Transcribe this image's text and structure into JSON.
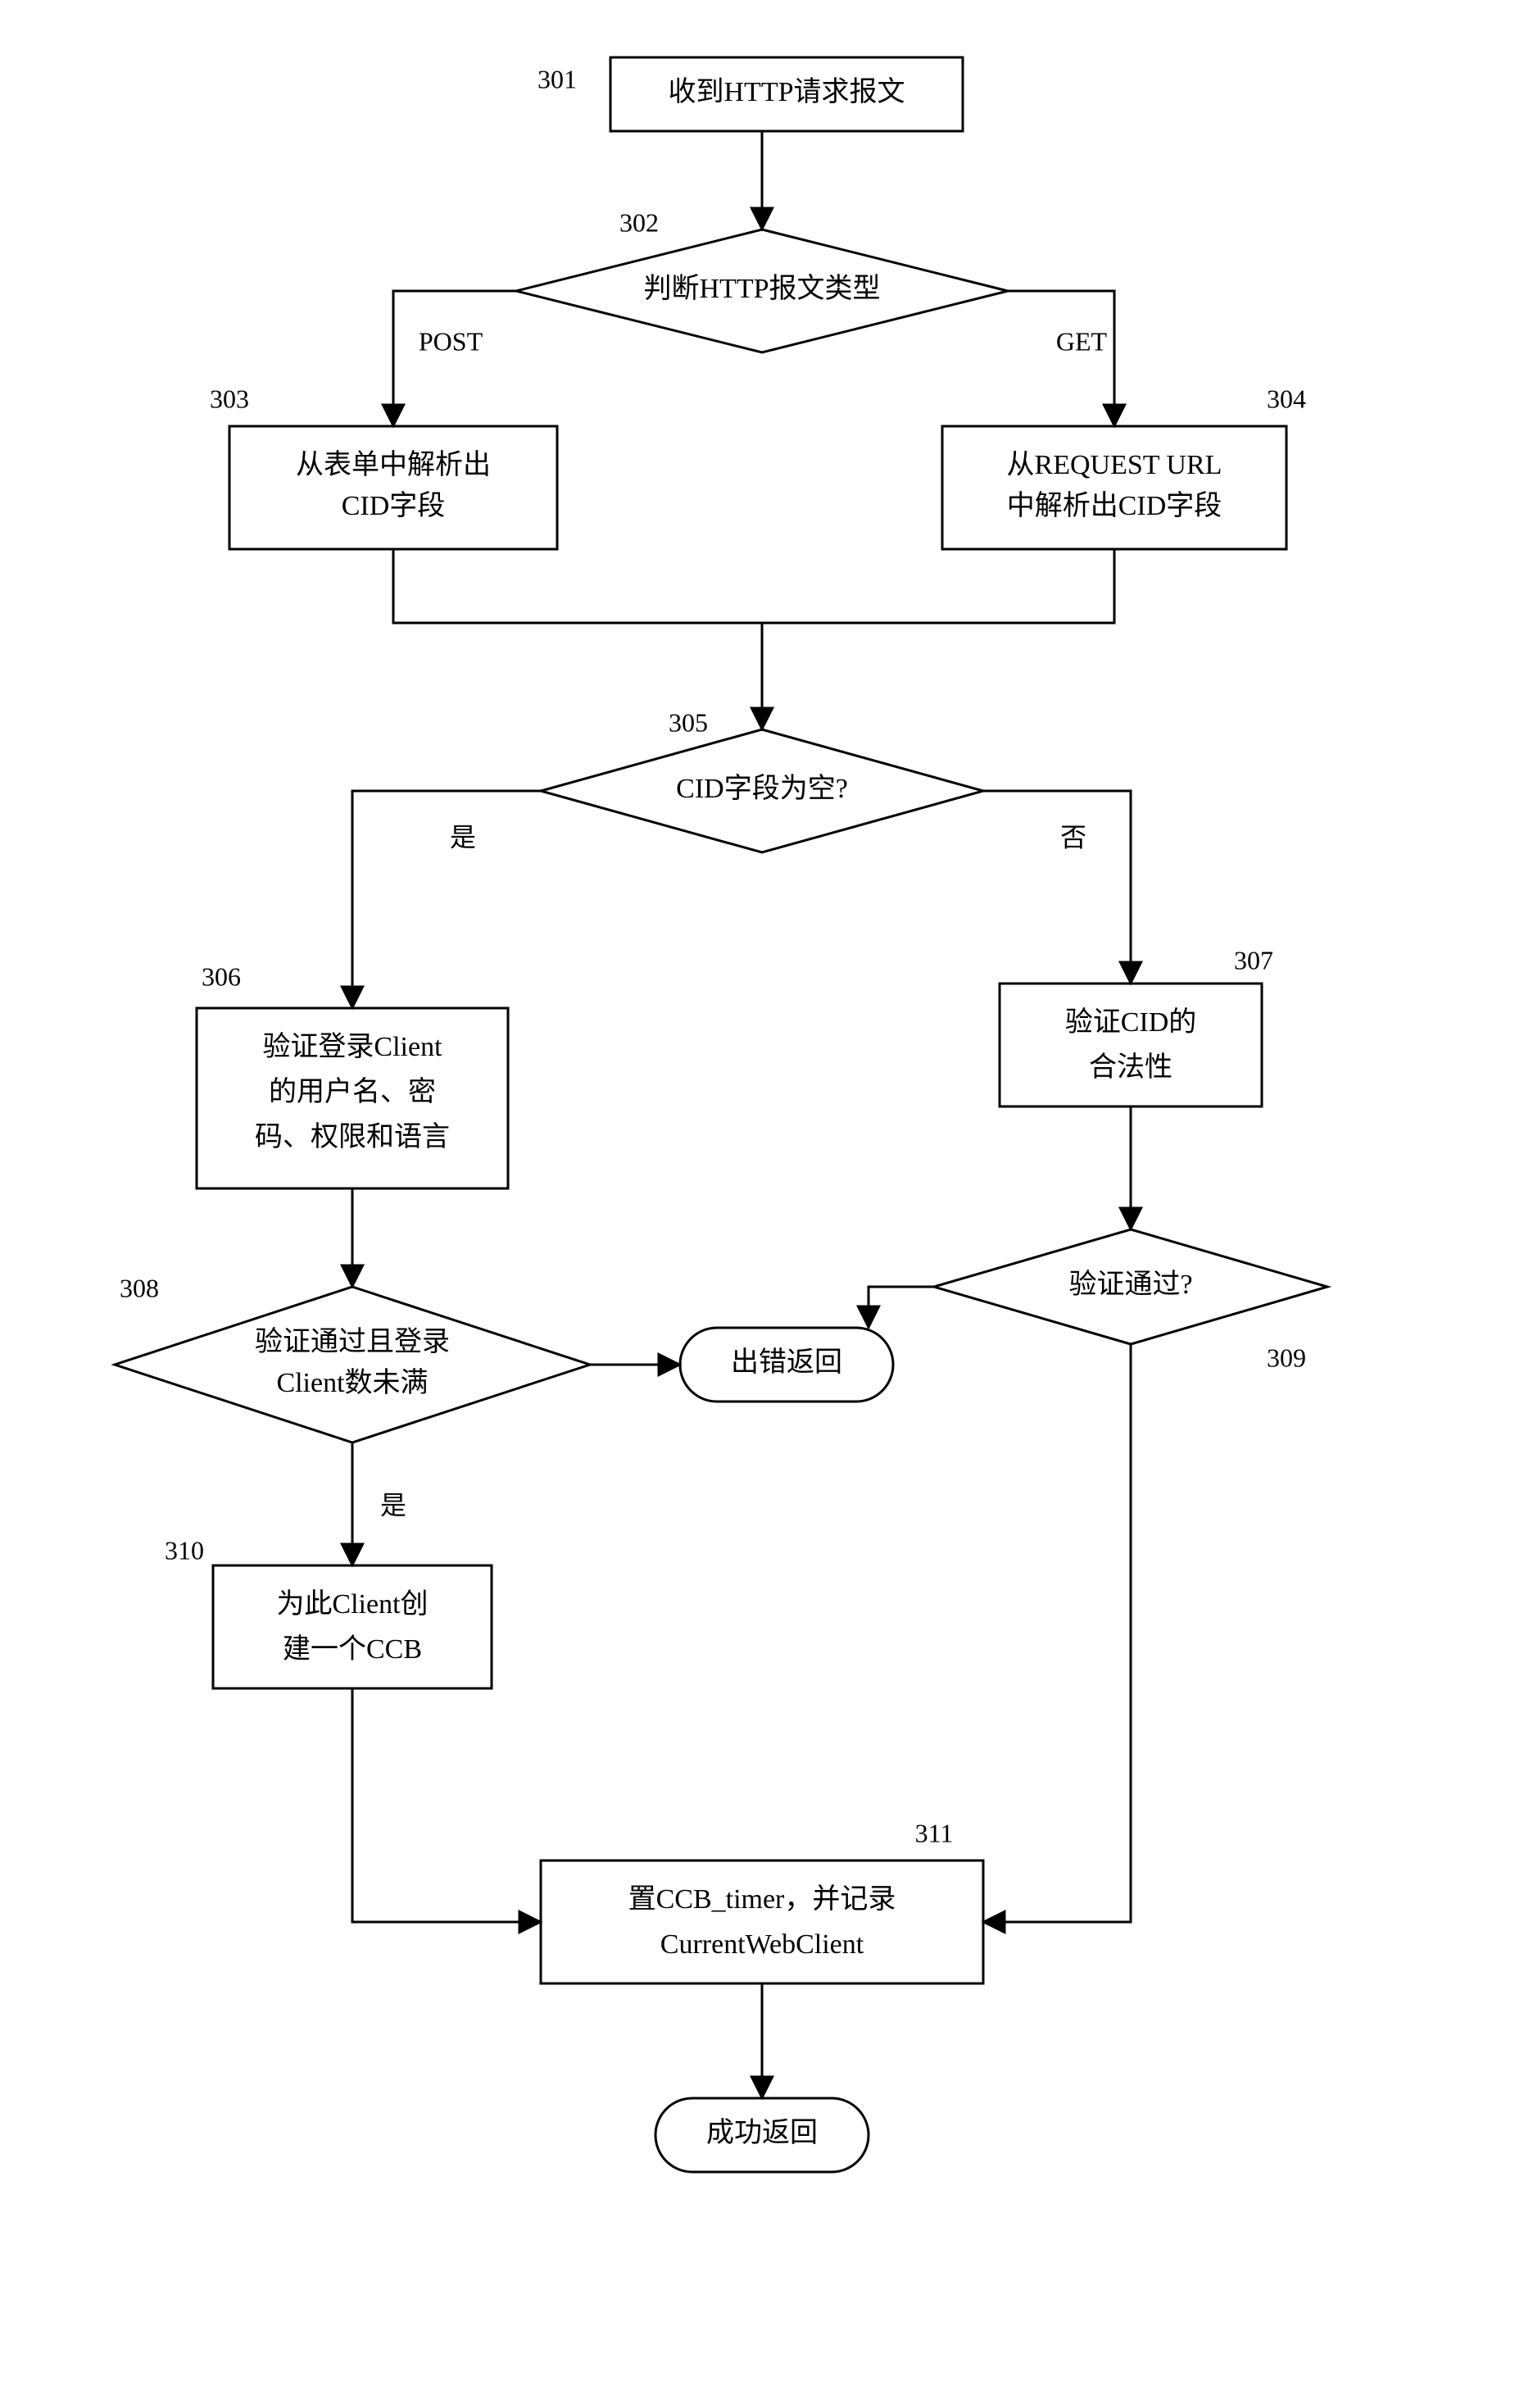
{
  "nodes": {
    "n301": {
      "num": "301",
      "lines": [
        "收到HTTP请求报文"
      ]
    },
    "n302": {
      "num": "302",
      "lines": [
        "判断HTTP报文类型"
      ]
    },
    "n303": {
      "num": "303",
      "lines": [
        "从表单中解析出",
        "CID字段"
      ]
    },
    "n304": {
      "num": "304",
      "lines": [
        "从REQUEST URL",
        "中解析出CID字段"
      ]
    },
    "n305": {
      "num": "305",
      "lines": [
        "CID字段为空?"
      ]
    },
    "n306": {
      "num": "306",
      "lines": [
        "验证登录Client",
        "的用户名、密",
        "码、权限和语言"
      ]
    },
    "n307": {
      "num": "307",
      "lines": [
        "验证CID的",
        "合法性"
      ]
    },
    "n308": {
      "num": "308",
      "lines": [
        "验证通过且登录",
        "Client数未满"
      ]
    },
    "n309": {
      "num": "309",
      "lines": [
        "验证通过?"
      ]
    },
    "n310": {
      "num": "310",
      "lines": [
        "为此Client创",
        "建一个CCB"
      ]
    },
    "n311": {
      "num": "311",
      "lines": [
        "置CCB_timer，并记录",
        "CurrentWebClient"
      ]
    },
    "err": {
      "lines": [
        "出错返回"
      ]
    },
    "ok": {
      "lines": [
        "成功返回"
      ]
    }
  },
  "edges": {
    "post": "POST",
    "get": "GET",
    "yes": "是",
    "no": "否"
  }
}
